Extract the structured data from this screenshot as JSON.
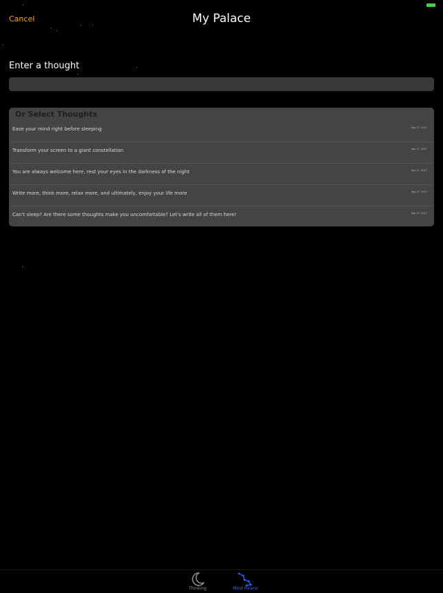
{
  "nav": {
    "cancel_label": "Cancel",
    "title": "My Palace"
  },
  "compose": {
    "prompt": "Enter a thought",
    "input_value": "",
    "input_placeholder": ""
  },
  "thoughts": {
    "header": "Or Select Thoughts",
    "items": [
      {
        "text": "Ease your mind right before sleeping",
        "date": "Sep 17, 2017"
      },
      {
        "text": "Transform your screen to a giant constellation",
        "date": "Sep 17, 2017"
      },
      {
        "text": "You are always welcome here, rest your eyes in the darkness of the night",
        "date": "Sep 17, 2017"
      },
      {
        "text": "Write more, think more, relax more, and ultimately, enjoy your life more",
        "date": "Sep 17, 2017"
      },
      {
        "text": "Can't sleep? Are there some thoughts make you uncomfortable? Let's write all of them here!",
        "date": "Sep 17, 2017"
      }
    ]
  },
  "tabbar": {
    "tabs": [
      {
        "label": "Thinking",
        "icon": "moon-icon",
        "selected": false
      },
      {
        "label": "Mind Palace",
        "icon": "constellation-icon",
        "selected": true
      }
    ]
  },
  "colors": {
    "accent": "#ff9f0a",
    "selected_tab": "#2f6bff",
    "unselected_tab": "#8e8e93",
    "background": "#000000",
    "panel": "#444446",
    "battery": "#3fd44a"
  }
}
